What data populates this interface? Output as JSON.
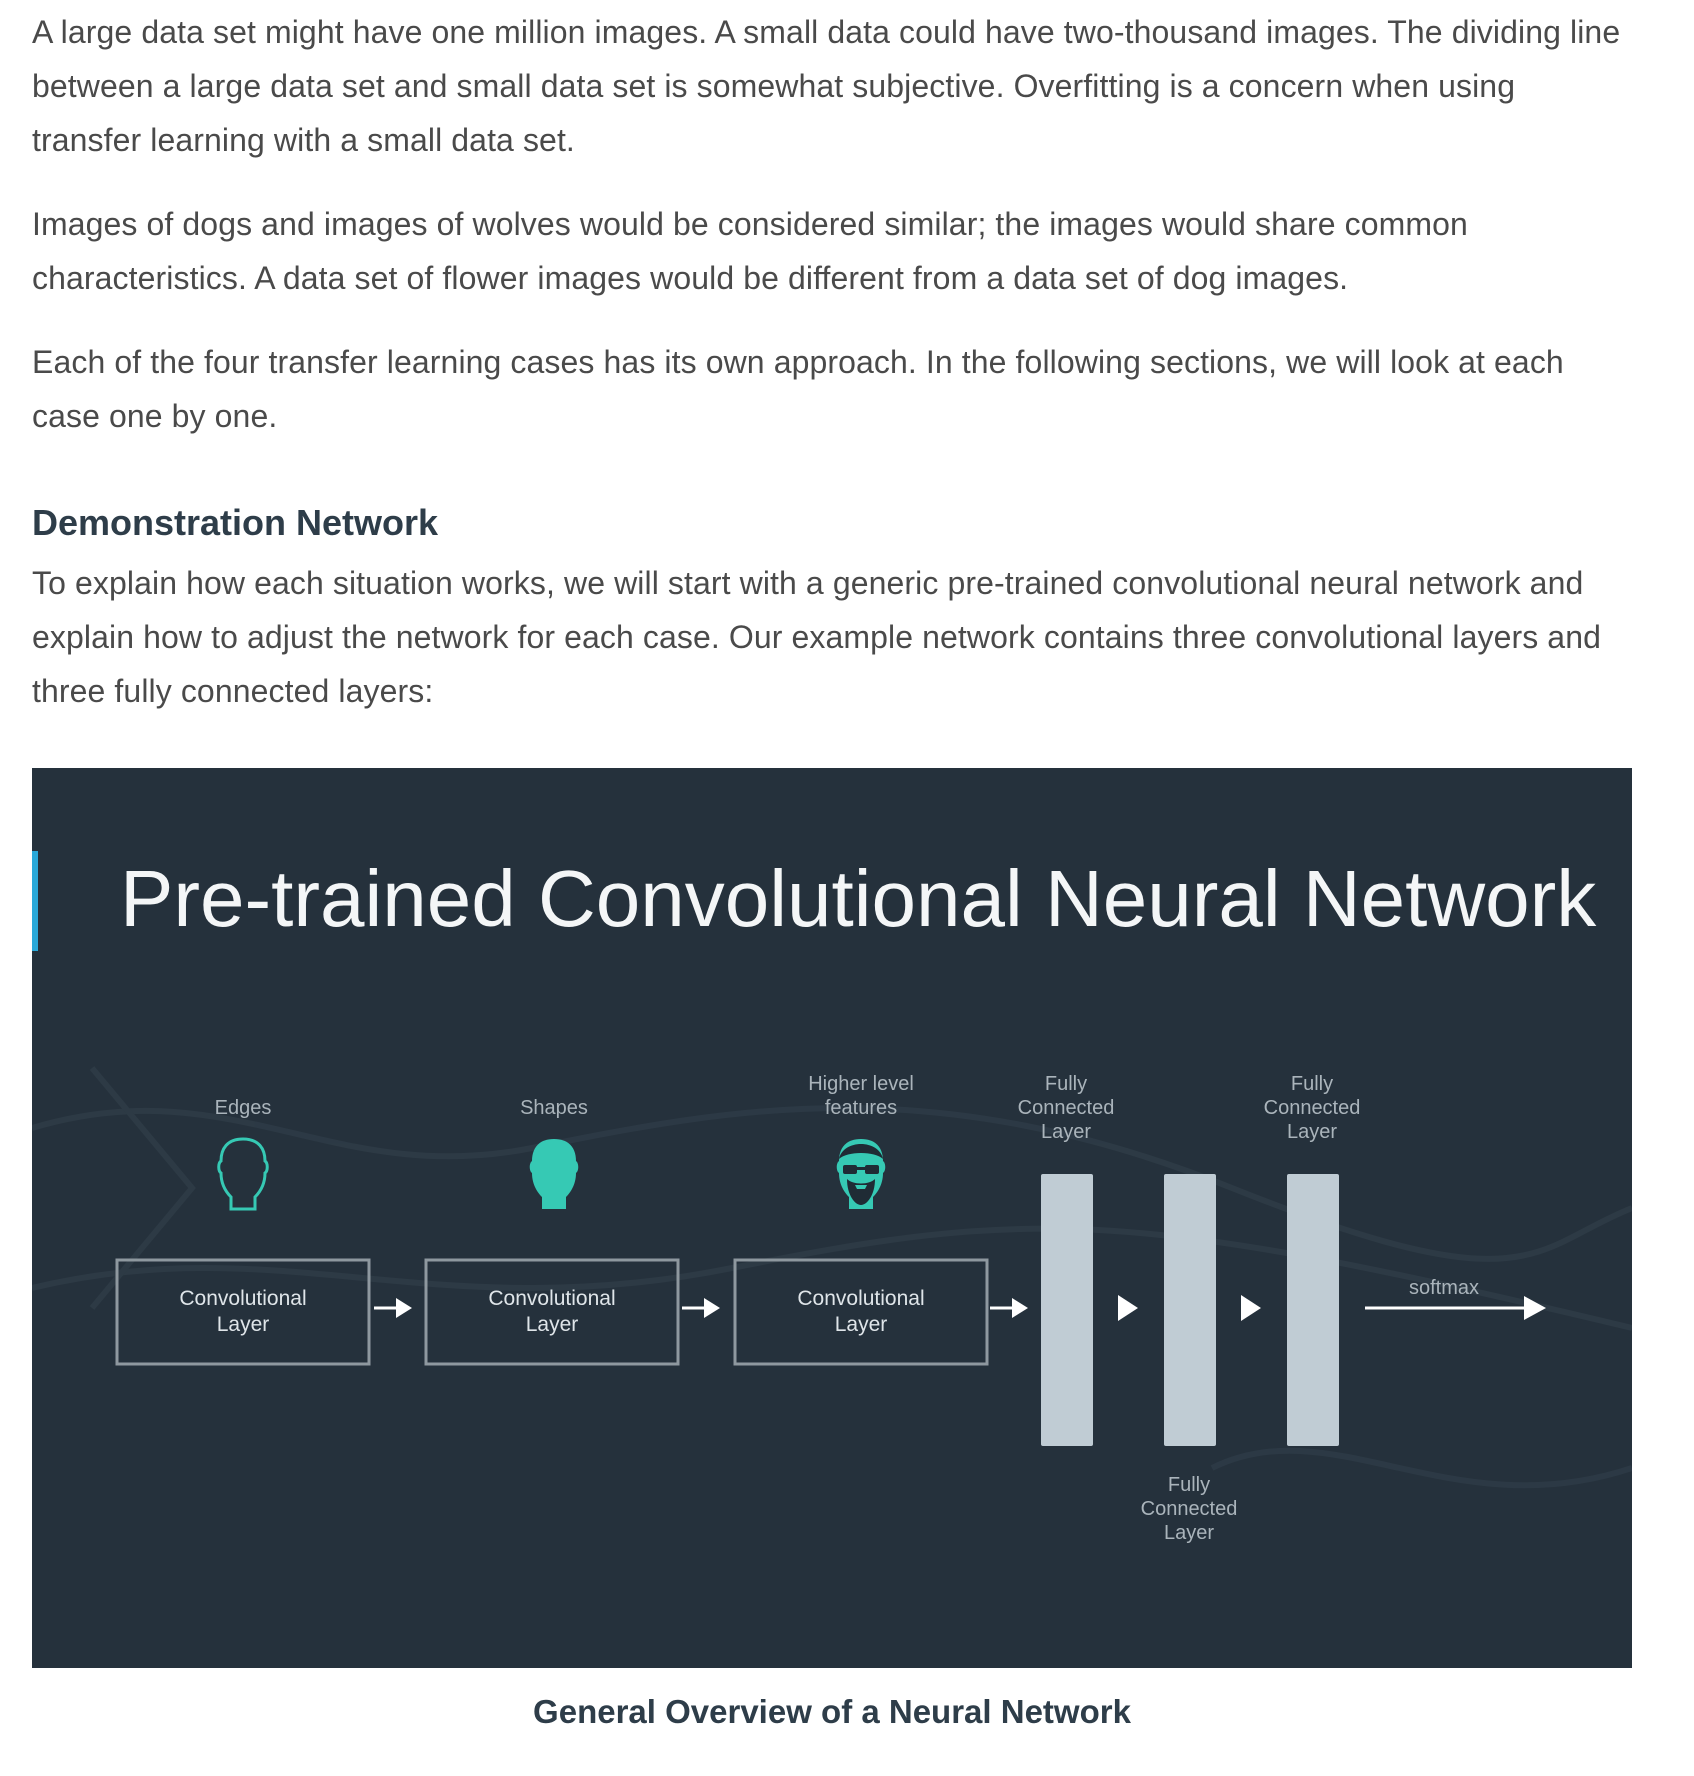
{
  "article": {
    "paragraph_1": "A large data set might have one million images. A small data could have two-thousand images. The dividing line between a large data set and small data set is somewhat subjective. Overfitting is a concern when using transfer learning with a small data set.",
    "paragraph_2": "Images of dogs and images of wolves would be considered similar; the images would share common characteristics. A data set of flower images would be different from a data set of dog images.",
    "paragraph_3": "Each of the four transfer learning cases has its own approach. In the following sections, we will look at each case one by one.",
    "section_heading": "Demonstration Network",
    "paragraph_4": "To explain how each situation works, we will start with a generic pre-trained convolutional neural network and explain how to adjust the network for each case. Our example network contains three convolutional layers and three fully connected layers:"
  },
  "figure": {
    "title": "Pre-trained Convolutional Neural Network",
    "feature_labels": {
      "edges": "Edges",
      "shapes": "Shapes",
      "higher_line1": "Higher level",
      "higher_line2": "features"
    },
    "conv_layers": [
      {
        "line1": "Convolutional",
        "line2": "Layer"
      },
      {
        "line1": "Convolutional",
        "line2": "Layer"
      },
      {
        "line1": "Convolutional",
        "line2": "Layer"
      }
    ],
    "fc_labels": [
      {
        "line1": "Fully",
        "line2": "Connected",
        "line3": "Layer"
      },
      {
        "line1": "Fully",
        "line2": "Connected",
        "line3": "Layer"
      },
      {
        "line1": "Fully",
        "line2": "Connected",
        "line3": "Layer"
      }
    ],
    "softmax_label": "softmax",
    "colors": {
      "background": "#25313c",
      "accent_bar": "#2aa8d8",
      "teal": "#36c9b4",
      "fc_bar": "#c0ccd4",
      "box_stroke": "#8e989f",
      "label_text": "#aab4bb"
    },
    "icons": [
      "head-outline-icon",
      "head-filled-icon",
      "bearded-man-icon",
      "arrow-right-icon",
      "triangle-right-icon"
    ]
  },
  "caption": "General Overview of a Neural Network"
}
